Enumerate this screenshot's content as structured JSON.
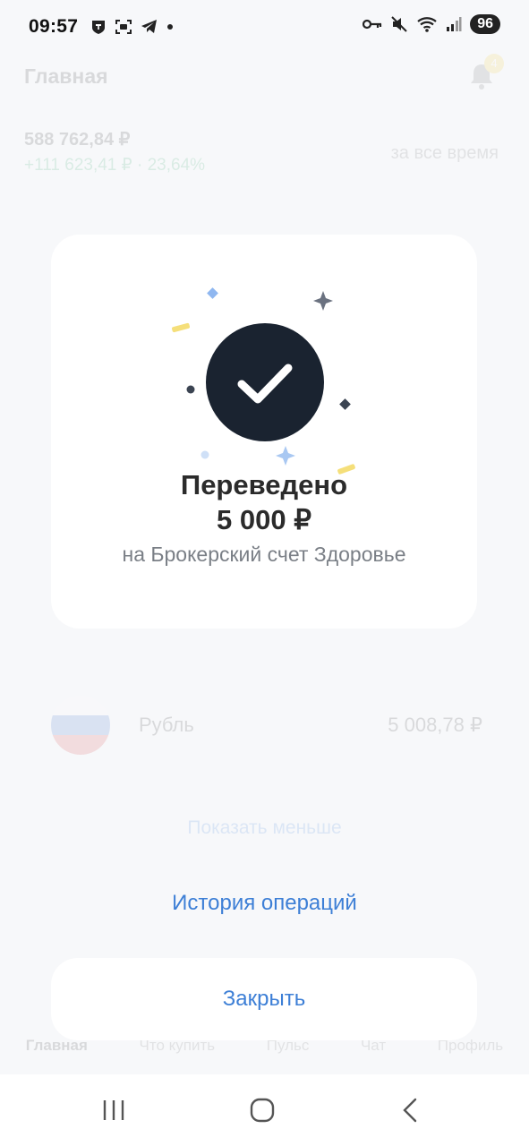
{
  "status_bar": {
    "time": "09:57",
    "battery": "96"
  },
  "background": {
    "title": "Главная",
    "bell_badge": "4",
    "total_amount": "588 762,84 ₽",
    "profit": "+111 623,41 ₽ · 23,64%",
    "period": "за все время",
    "currency_row": {
      "name": "Рубль",
      "value": "5 008,78 ₽"
    },
    "show_less": "Показать меньше",
    "tabs": [
      "Главная",
      "Что купить",
      "Пульс",
      "Чат",
      "Профиль"
    ]
  },
  "modal": {
    "title": "Переведено",
    "amount": "5 000 ₽",
    "subtitle": "на Брокерский счет Здоровье"
  },
  "history_link": "История операций",
  "close_button": "Закрыть",
  "colors": {
    "accent": "#3d7fd6",
    "check_circle": "#1a2330",
    "background": "#f7f8fa"
  }
}
